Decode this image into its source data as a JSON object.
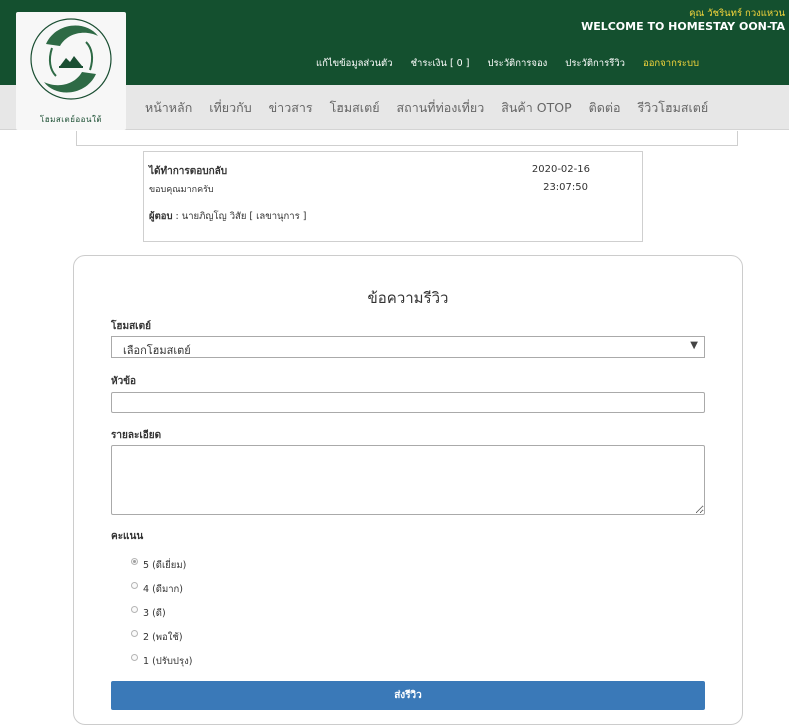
{
  "header": {
    "logo_text": "โฮมสเตย์ออนใต้",
    "user_name": "คุณ วัชรินทร์ กวงแหวน",
    "welcome": "WELCOME TO HOMESTAY OON-TA",
    "user_menu": [
      "แก้ไขข้อมูลส่วนตัว",
      "ชำระเงิน [ 0 ]",
      "ประวัติการจอง",
      "ประวัติการรีวิว",
      "ออกจากระบบ"
    ]
  },
  "nav": {
    "items": [
      "หน้าหลัก",
      "เที่ยวกับ",
      "ข่าวสาร",
      "โฮมสเตย์",
      "สถานที่ท่องเที่ยว",
      "สินค้า OTOP",
      "ติดต่อ",
      "รีวิวโฮมสเตย์"
    ]
  },
  "reply": {
    "title": "ได้ทำการตอบกลับ",
    "message": "ขอบคุณมากครับ",
    "date": "2020-02-16",
    "time": "23:07:50",
    "by_label": "ผู้ตอบ",
    "by_value": " : นายภิญโญ วิสัย [ เลขานุการ ]"
  },
  "form": {
    "title": "ข้อความรีวิว",
    "homestay_label": "โฮมสเตย์",
    "homestay_selected": "เลือกโฮมสเตย์",
    "subject_label": "หัวข้อ",
    "detail_label": "รายละเอียด",
    "rating_label": "คะแนน",
    "ratings": [
      "5 (ดีเยี่ยม)",
      "4 (ดีมาก)",
      "3 (ดี)",
      "2 (พอใช้)",
      "1 (ปรับปรุง)"
    ],
    "selected_rating": 0,
    "submit_label": "ส่งรีวิว"
  },
  "colors": {
    "header_bg": "#14502f",
    "accent_yellow": "#f5d63c",
    "button_blue": "#3a79b8"
  }
}
